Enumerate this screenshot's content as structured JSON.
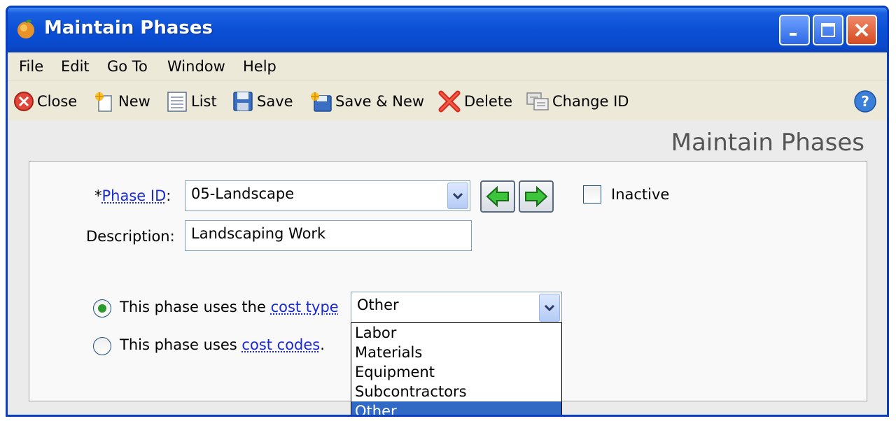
{
  "window": {
    "title": "Maintain Phases"
  },
  "menu": [
    "File",
    "Edit",
    "Go To",
    "Window",
    "Help"
  ],
  "toolbar": {
    "close": "Close",
    "new": "New",
    "list": "List",
    "save": "Save",
    "save_new": "Save & New",
    "delete": "Delete",
    "change_id": "Change ID"
  },
  "page_heading": "Maintain Phases",
  "form": {
    "phase_id_prefix": "*",
    "phase_id_label": "Phase ID",
    "phase_id_colon": ":",
    "phase_id_value": "05-Landscape",
    "description_label": "Description:",
    "description_value": "Landscaping Work",
    "inactive_label": "Inactive",
    "inactive_checked": false,
    "cost_type_text": "This phase uses the ",
    "cost_type_link": "cost type",
    "cost_type_selected": true,
    "cost_codes_text": "This phase uses ",
    "cost_codes_link": "cost codes",
    "cost_codes_suffix": ".",
    "cost_type_value": "Other",
    "cost_type_options": [
      "Labor",
      "Materials",
      "Equipment",
      "Subcontractors",
      "Other"
    ],
    "cost_type_highlighted": "Other"
  },
  "colors": {
    "title_bar": "#0b4fd6",
    "selection": "#316ac5",
    "link": "#1a2bd6"
  }
}
